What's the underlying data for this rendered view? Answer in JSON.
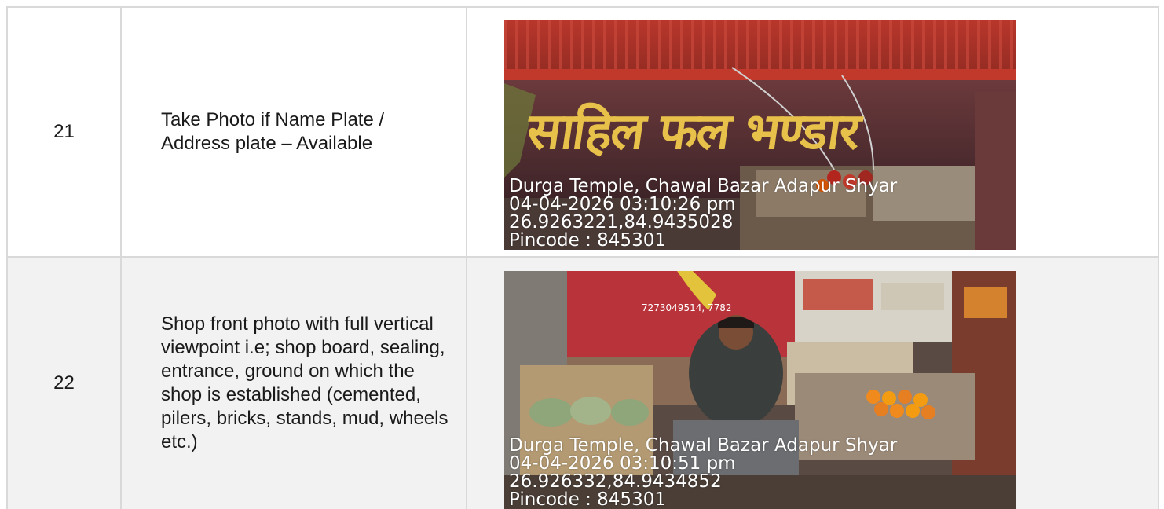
{
  "rows": [
    {
      "number": "21",
      "description": "Take Photo if Name Plate / Address plate – Available",
      "photo": {
        "sign_text": "साहिल फल भण्डार",
        "stamp": [
          "Durga Temple, Chawal Bazar Adapur Shyar",
          "04-04-2026 03:10:26 pm",
          "26.9263221,84.9435028",
          "Pincode : 845301"
        ]
      }
    },
    {
      "number": "22",
      "description": "Shop front photo with full vertical viewpoint i.e; shop board, sealing, entrance, ground on which the shop is established (cemented, pilers, bricks, stands, mud, wheels etc.)",
      "photo": {
        "sign_text": "7273049514, 7782",
        "stamp": [
          "Durga Temple, Chawal Bazar Adapur Shyar",
          "04-04-2026 03:10:51 pm",
          "26.926332,84.9434852",
          "Pincode : 845301"
        ]
      }
    }
  ],
  "colors": {
    "border": "#d9d9d9",
    "row_alt": "#f2f2f2",
    "stamp_text": "#ffffff"
  }
}
